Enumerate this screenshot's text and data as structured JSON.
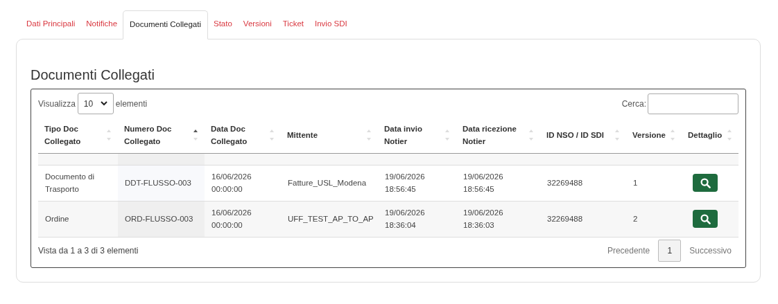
{
  "tabs": [
    {
      "label": "Dati Principali",
      "selected": false
    },
    {
      "label": "Notifiche",
      "selected": false
    },
    {
      "label": "Documenti Collegati",
      "selected": true
    },
    {
      "label": "Stato",
      "selected": false
    },
    {
      "label": "Versioni",
      "selected": false
    },
    {
      "label": "Ticket",
      "selected": false
    },
    {
      "label": "Invio SDI",
      "selected": false
    }
  ],
  "heading": "Documenti Collegati",
  "length_control": {
    "before": "Visualizza",
    "value": "10",
    "after": "elementi"
  },
  "search": {
    "label": "Cerca:"
  },
  "table": {
    "columns": [
      {
        "label": "Tipo Doc Collegato",
        "sorted_ascending": false
      },
      {
        "label": "Numero Doc Collegato",
        "sorted_ascending": true
      },
      {
        "label": "Data Doc Collegato",
        "sorted_ascending": false
      },
      {
        "label": "Mittente",
        "sorted_ascending": false
      },
      {
        "label": "Data invio Notier",
        "sorted_ascending": false
      },
      {
        "label": "Data ricezione Notier",
        "sorted_ascending": false
      },
      {
        "label": "ID NSO / ID SDI",
        "sorted_ascending": false
      },
      {
        "label": "Versione",
        "sorted_ascending": false
      },
      {
        "label": "Dettaglio",
        "sorted_ascending": false
      }
    ],
    "rows": [
      {
        "kind": "blank"
      },
      {
        "kind": "data",
        "cells": [
          "Documento di Trasporto",
          "DDT-FLUSSO-003",
          "16/06/2026 00:00:00",
          "Fatture_USL_Modena",
          "19/06/2026 18:56:45",
          "19/06/2026 18:56:45",
          "32269488",
          "1"
        ]
      },
      {
        "kind": "data",
        "cells": [
          "Ordine",
          "ORD-FLUSSO-003",
          "16/06/2026 00:00:00",
          "UFF_TEST_AP_TO_AP",
          "19/06/2026 18:36:04",
          "19/06/2026 18:36:03",
          "32269488",
          "2"
        ]
      }
    ]
  },
  "info": "Vista da 1 a 3 di 3 elementi",
  "pagination": {
    "previous": "Precedente",
    "pages": [
      {
        "label": "1",
        "selected": true
      }
    ],
    "next": "Successivo"
  }
}
